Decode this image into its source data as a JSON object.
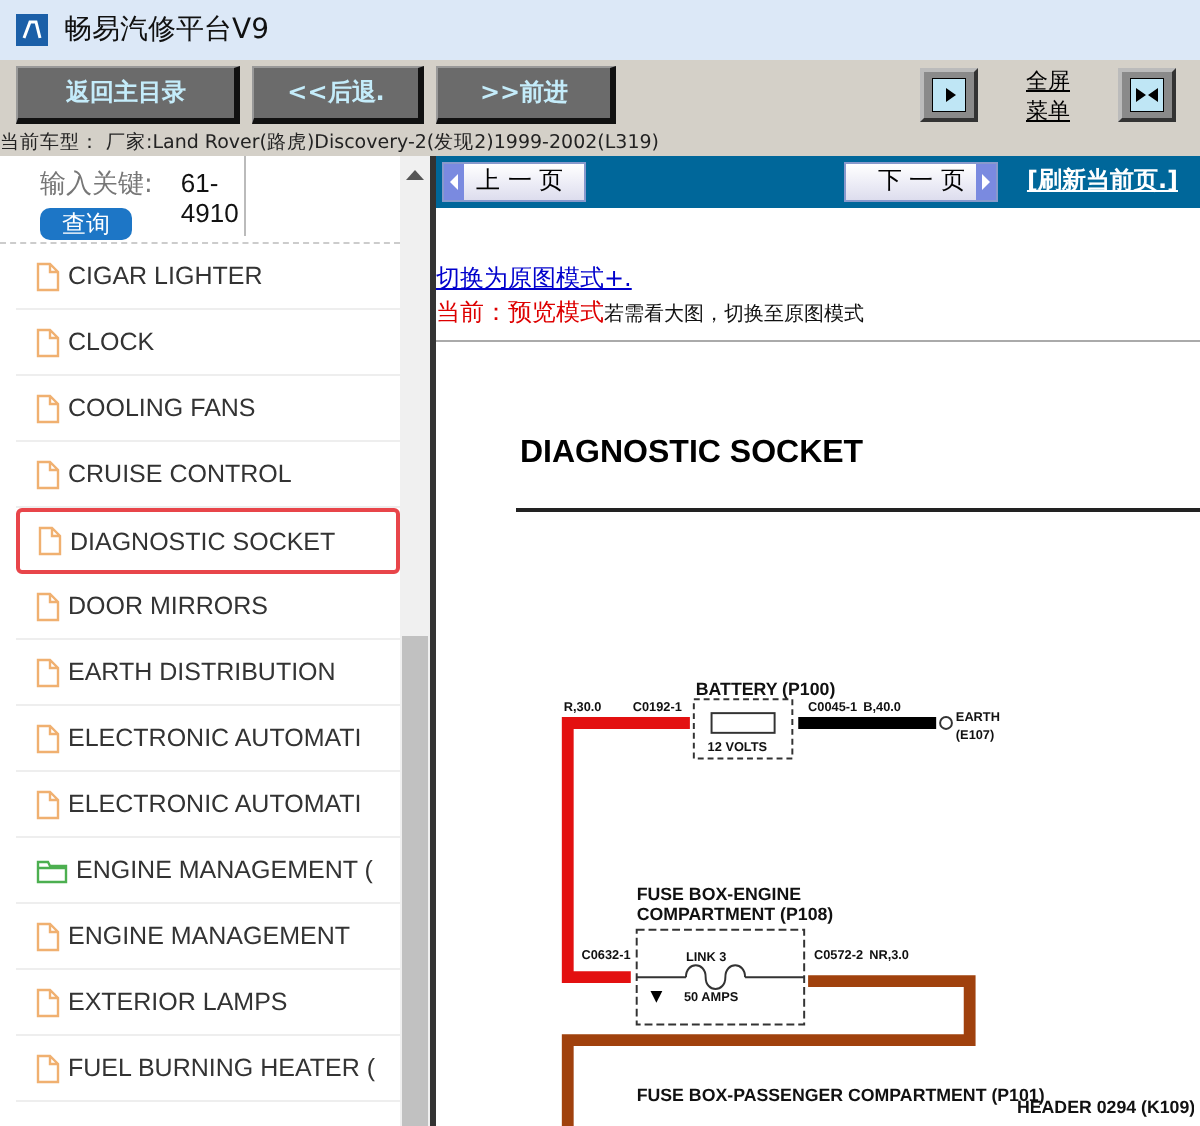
{
  "window": {
    "title": "畅易汽修平台V9"
  },
  "toolbar": {
    "buttons": [
      "返回主目录",
      "<<后退.",
      ">>前进"
    ],
    "fullscreen_link": "全屏菜单"
  },
  "vehicle_line": "当前车型： 厂家:Land Rover(路虎)Discovery-2(发现2)1999-2002(L319)",
  "search": {
    "label": "输入关键:",
    "value": "61-4910",
    "button": "查询"
  },
  "tree": [
    {
      "label": "CIGAR LIGHTER",
      "kind": "file",
      "selected": false
    },
    {
      "label": "CLOCK",
      "kind": "file",
      "selected": false
    },
    {
      "label": "COOLING FANS",
      "kind": "file",
      "selected": false
    },
    {
      "label": "CRUISE CONTROL",
      "kind": "file",
      "selected": false
    },
    {
      "label": "DIAGNOSTIC SOCKET",
      "kind": "file",
      "selected": true
    },
    {
      "label": "DOOR MIRRORS",
      "kind": "file",
      "selected": false
    },
    {
      "label": "EARTH DISTRIBUTION",
      "kind": "file",
      "selected": false
    },
    {
      "label": "ELECTRONIC AUTOMATI",
      "kind": "file",
      "selected": false
    },
    {
      "label": "ELECTRONIC AUTOMATI",
      "kind": "file",
      "selected": false
    },
    {
      "label": "ENGINE MANAGEMENT (",
      "kind": "folder",
      "selected": false
    },
    {
      "label": "ENGINE MANAGEMENT",
      "kind": "file",
      "selected": false
    },
    {
      "label": "EXTERIOR LAMPS",
      "kind": "file",
      "selected": false
    },
    {
      "label": "FUEL BURNING HEATER (",
      "kind": "file",
      "selected": false
    }
  ],
  "pager": {
    "prev": "上 一 页",
    "next": "下 一 页",
    "refresh": "[刷新当前页.]"
  },
  "mode_link": "切换为原图模式+.",
  "mode_status": {
    "current": "当前：预览模式",
    "hint": "若需看大图，切换至原图模式"
  },
  "document_title": "DIAGNOSTIC SOCKET",
  "diagram": {
    "labels": [
      "R,30.0",
      "C0192-1",
      "BATTERY (P100)",
      "12 VOLTS",
      "C0045-1",
      "B,40.0",
      "EARTH",
      "(E107)",
      "FUSE BOX-ENGINE",
      "COMPARTMENT (P108)",
      "LINK 3",
      "50 AMPS",
      "C0632-1",
      "C0572-2",
      "NR,3.0",
      "FUSE BOX-PASSENGER COMPARTMENT (P101)",
      "HEADER 0294 (K109)"
    ]
  }
}
